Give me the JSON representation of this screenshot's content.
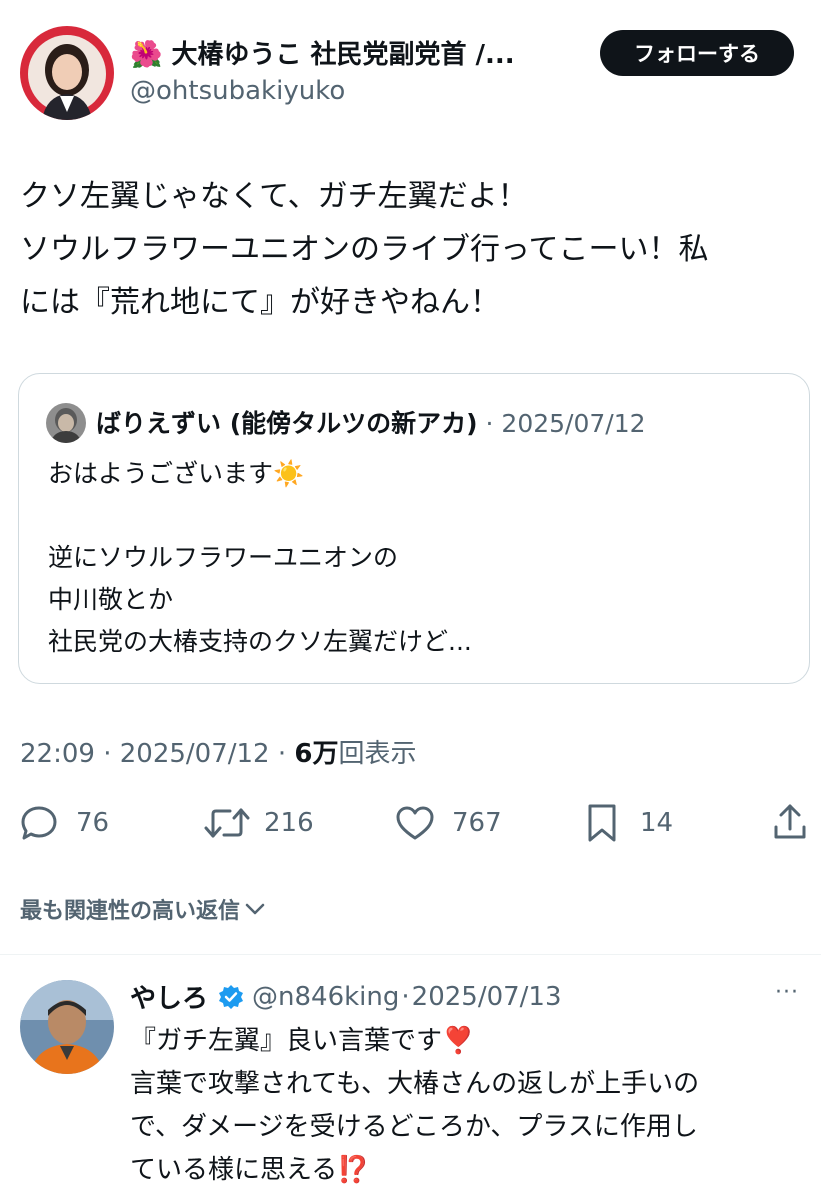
{
  "author": {
    "flower_emoji": "🌺",
    "display_name": "大椿ゆうこ 社民党副党首 /...",
    "handle": "@ohtsubakiyuko",
    "follow_label": "フォローする"
  },
  "tweet": {
    "lines": [
      "クソ左翼じゃなくて、ガチ左翼だよ！",
      "ソウルフラワーユニオンのライブ行ってこーい！私",
      "には『荒れ地にて』が好きやねん！"
    ]
  },
  "quote": {
    "author_name": "ばりえずい (能傍タルツの新アカ)",
    "separator": "·",
    "date": "2025/07/12",
    "line1": "おはようございます",
    "line1_emoji": "☀️",
    "lines": [
      "逆にソウルフラワーユニオンの",
      "中川敬とか",
      "社民党の大椿支持のクソ左翼だけど..."
    ]
  },
  "meta": {
    "time": "22:09",
    "sep1": "·",
    "date": "2025/07/12",
    "sep2": "·",
    "views_count": "6万",
    "views_label": "回表示"
  },
  "actions": {
    "replies": "76",
    "retweets": "216",
    "likes": "767",
    "bookmarks": "14"
  },
  "replies_sort_label": "最も関連性の高い返信",
  "reply": {
    "name": "やしろ",
    "handle": "@n846king",
    "separator": "·",
    "date": "2025/07/13",
    "more": "···",
    "line1": "『ガチ左翼』良い言葉です",
    "line1_emoji": "❣️",
    "line2": "言葉で攻撃されても、大椿さんの返しが上手いの",
    "line3": "で、ダメージを受けるどころか、プラスに作用し",
    "line4": "ている様に思える",
    "line4_emoji": "⁉️"
  },
  "colors": {
    "text": "#0f1419",
    "muted": "#536471",
    "border": "#cfd9de",
    "verified": "#1d9bf0",
    "follow_bg": "#0f1419",
    "avatar_ring": "#d8293b"
  }
}
